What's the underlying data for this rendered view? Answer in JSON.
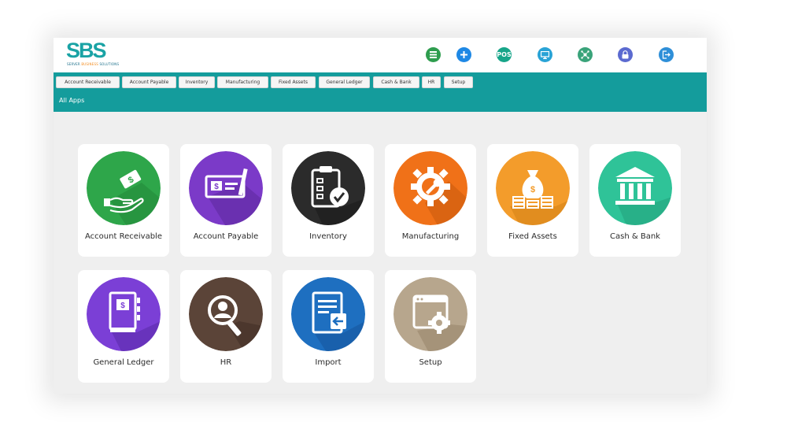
{
  "header": {
    "logo_text": "SBS",
    "logo_tagline_parts": [
      "SERVER",
      "BUSINESS",
      "SOLUTIONS"
    ],
    "icons": [
      {
        "name": "grid-icon",
        "color": "#2e9d4e",
        "text": ""
      },
      {
        "name": "plus-icon",
        "color": "#1e88e5",
        "text": ""
      },
      {
        "name": "pos-icon",
        "color": "#17a589",
        "text": "POS"
      },
      {
        "name": "monitor-icon",
        "color": "#29a3d6",
        "text": ""
      },
      {
        "name": "network-icon",
        "color": "#3aa37a",
        "text": ""
      },
      {
        "name": "lock-icon",
        "color": "#5b6ad0",
        "text": ""
      },
      {
        "name": "logout-icon",
        "color": "#2f8fd8",
        "text": ""
      }
    ]
  },
  "menu": {
    "items": [
      "Account Receivable",
      "Account Payable",
      "Inventory",
      "Manufacturing",
      "Fixed Assets",
      "General Ledger",
      "Cash & Bank",
      "HR",
      "Setup"
    ],
    "section_label": "All Apps"
  },
  "apps": [
    {
      "label": "Account Receivable",
      "icon": "cash-hand-icon",
      "color": "#2ea64a"
    },
    {
      "label": "Account Payable",
      "icon": "cheque-icon",
      "color": "#7b3ac8"
    },
    {
      "label": "Inventory",
      "icon": "clipboard-check-icon",
      "color": "#2b2b2b"
    },
    {
      "label": "Manufacturing",
      "icon": "gear-wrench-icon",
      "color": "#f07118"
    },
    {
      "label": "Fixed Assets",
      "icon": "money-bag-icon",
      "color": "#f39c2b"
    },
    {
      "label": "Cash & Bank",
      "icon": "bank-icon",
      "color": "#2fc398"
    },
    {
      "label": "General Ledger",
      "icon": "ledger-book-icon",
      "color": "#7b3fd6"
    },
    {
      "label": "HR",
      "icon": "person-search-icon",
      "color": "#5b4438"
    },
    {
      "label": "Import",
      "icon": "import-document-icon",
      "color": "#1e6fc0"
    },
    {
      "label": "Setup",
      "icon": "settings-window-icon",
      "color": "#b7a68d"
    }
  ]
}
